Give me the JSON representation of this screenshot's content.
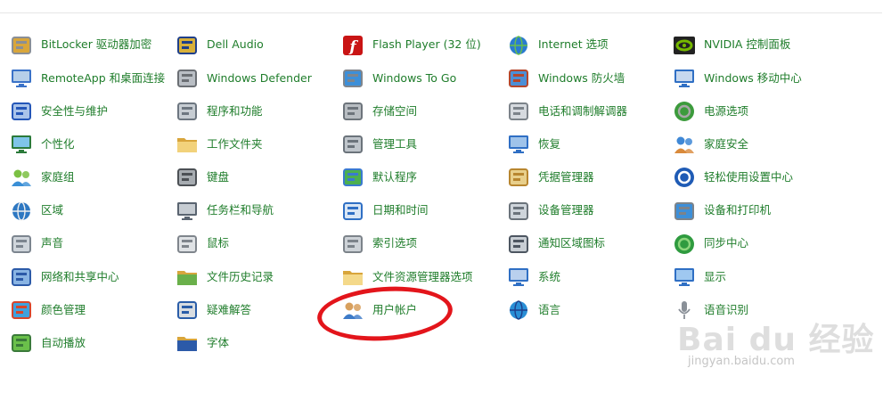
{
  "columns": [
    {
      "items": [
        {
          "label": "BitLocker 驱动器加密",
          "icon": "bitlocker-icon"
        },
        {
          "label": "RemoteApp 和桌面连接",
          "icon": "remoteapp-icon"
        },
        {
          "label": "安全性与维护",
          "icon": "flag-icon"
        },
        {
          "label": "个性化",
          "icon": "personalize-icon"
        },
        {
          "label": "家庭组",
          "icon": "homegroup-icon"
        },
        {
          "label": "区域",
          "icon": "globe-clock-icon"
        },
        {
          "label": "声音",
          "icon": "speaker-icon"
        },
        {
          "label": "网络和共享中心",
          "icon": "network-icon"
        },
        {
          "label": "颜色管理",
          "icon": "color-management-icon"
        },
        {
          "label": "自动播放",
          "icon": "autoplay-icon"
        }
      ]
    },
    {
      "items": [
        {
          "label": "Dell Audio",
          "icon": "dell-audio-icon"
        },
        {
          "label": "Windows Defender",
          "icon": "defender-wall-icon"
        },
        {
          "label": "程序和功能",
          "icon": "programs-icon"
        },
        {
          "label": "工作文件夹",
          "icon": "work-folders-icon"
        },
        {
          "label": "键盘",
          "icon": "keyboard-icon"
        },
        {
          "label": "任务栏和导航",
          "icon": "taskbar-icon"
        },
        {
          "label": "鼠标",
          "icon": "mouse-icon"
        },
        {
          "label": "文件历史记录",
          "icon": "file-history-icon"
        },
        {
          "label": "疑难解答",
          "icon": "troubleshoot-icon"
        },
        {
          "label": "字体",
          "icon": "fonts-icon"
        }
      ]
    },
    {
      "items": [
        {
          "label": "Flash Player (32 位)",
          "icon": "flash-icon"
        },
        {
          "label": "Windows To Go",
          "icon": "windows-to-go-icon"
        },
        {
          "label": "存储空间",
          "icon": "storage-spaces-icon"
        },
        {
          "label": "管理工具",
          "icon": "admin-tools-icon"
        },
        {
          "label": "默认程序",
          "icon": "default-programs-icon"
        },
        {
          "label": "日期和时间",
          "icon": "calendar-clock-icon"
        },
        {
          "label": "索引选项",
          "icon": "indexing-icon"
        },
        {
          "label": "文件资源管理器选项",
          "icon": "folder-options-icon"
        },
        {
          "label": "用户帐户",
          "icon": "user-accounts-icon"
        }
      ]
    },
    {
      "items": [
        {
          "label": "Internet 选项",
          "icon": "internet-options-icon"
        },
        {
          "label": "Windows 防火墙",
          "icon": "firewall-icon"
        },
        {
          "label": "电话和调制解调器",
          "icon": "phone-modem-icon"
        },
        {
          "label": "恢复",
          "icon": "recovery-icon"
        },
        {
          "label": "凭据管理器",
          "icon": "credential-icon"
        },
        {
          "label": "设备管理器",
          "icon": "device-manager-icon"
        },
        {
          "label": "通知区域图标",
          "icon": "notification-icon"
        },
        {
          "label": "系统",
          "icon": "system-icon"
        },
        {
          "label": "语言",
          "icon": "language-icon"
        }
      ]
    },
    {
      "items": [
        {
          "label": "NVIDIA 控制面板",
          "icon": "nvidia-icon"
        },
        {
          "label": "Windows 移动中心",
          "icon": "mobility-center-icon"
        },
        {
          "label": "电源选项",
          "icon": "power-options-icon"
        },
        {
          "label": "家庭安全",
          "icon": "family-safety-icon"
        },
        {
          "label": "轻松使用设置中心",
          "icon": "ease-of-access-icon"
        },
        {
          "label": "设备和打印机",
          "icon": "devices-printers-icon"
        },
        {
          "label": "同步中心",
          "icon": "sync-center-icon"
        },
        {
          "label": "显示",
          "icon": "display-icon"
        },
        {
          "label": "语音识别",
          "icon": "microphone-icon"
        }
      ]
    }
  ],
  "watermark": {
    "logo_text": "Bai du 经验",
    "url": "jingyan.baidu.com"
  },
  "colors": {
    "label": "#1f7d2b",
    "annotation": "#e3151b"
  }
}
